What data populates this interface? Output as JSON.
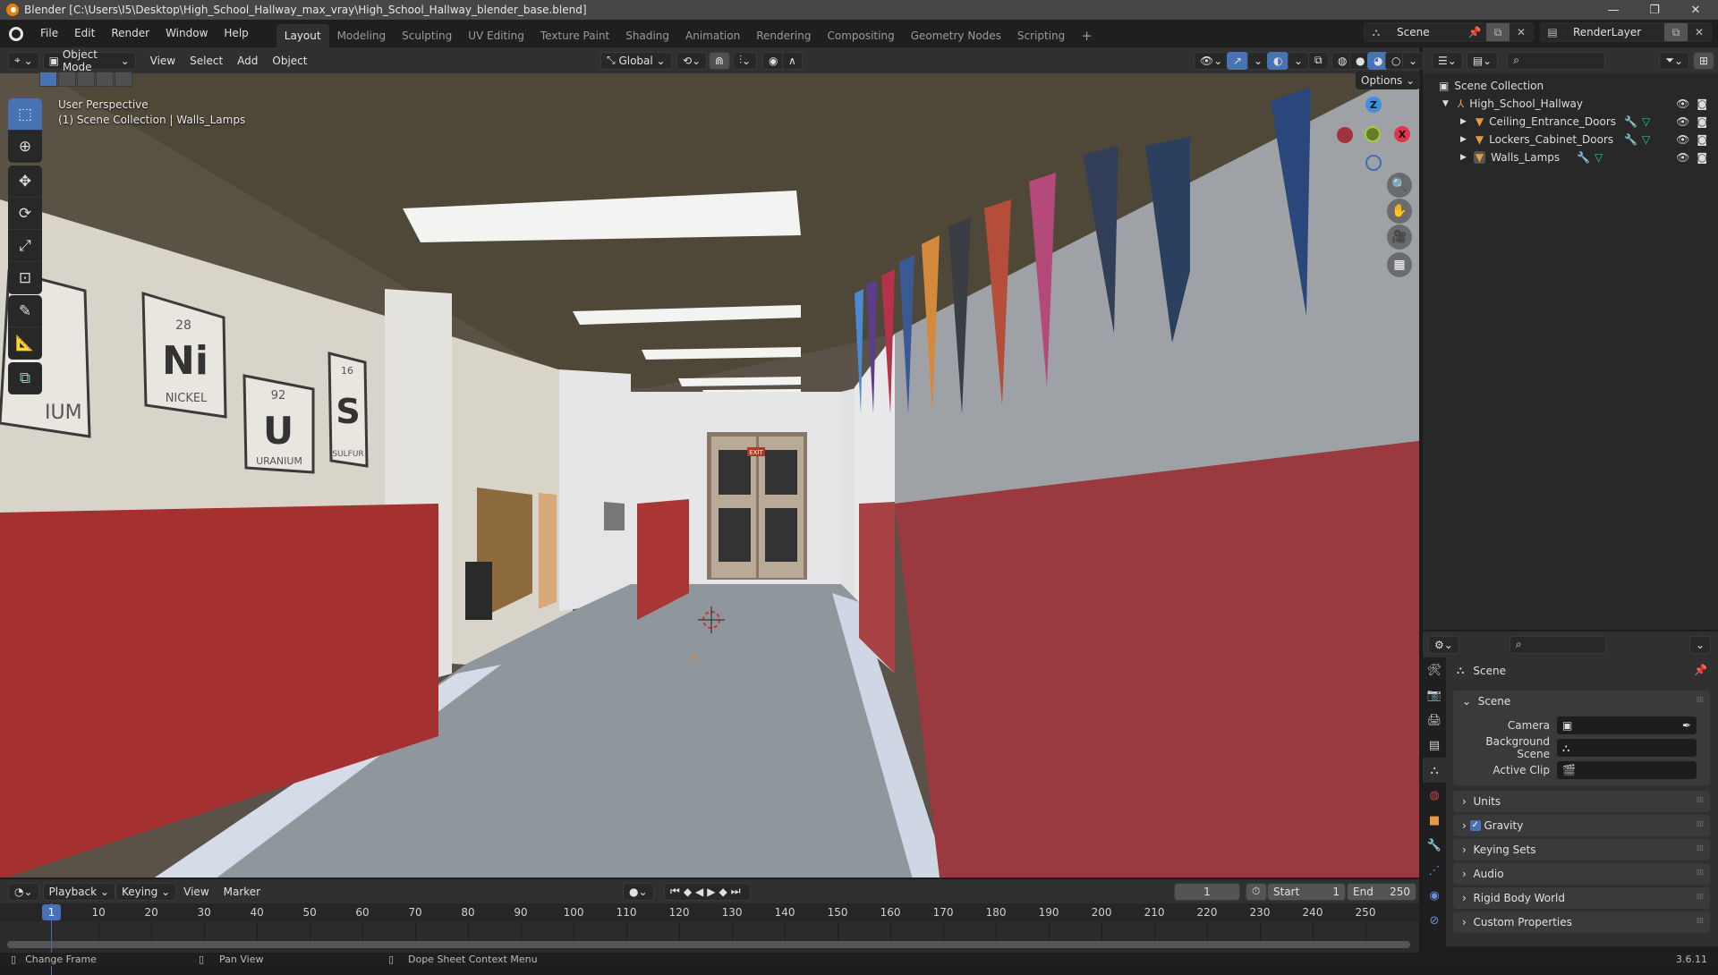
{
  "window": {
    "title": "Blender [C:\\Users\\I5\\Desktop\\High_School_Hallway_max_vray\\High_School_Hallway_blender_base.blend]",
    "controls": [
      "minimize",
      "maximize",
      "close"
    ]
  },
  "menubar": {
    "items": [
      "File",
      "Edit",
      "Render",
      "Window",
      "Help"
    ],
    "workspaces": [
      "Layout",
      "Modeling",
      "Sculpting",
      "UV Editing",
      "Texture Paint",
      "Shading",
      "Animation",
      "Rendering",
      "Compositing",
      "Geometry Nodes",
      "Scripting"
    ],
    "active_workspace": "Layout",
    "add_workspace": "+",
    "scene": "Scene",
    "view_layer": "RenderLayer"
  },
  "viewport": {
    "mode": "Object Mode",
    "menus": [
      "View",
      "Select",
      "Add",
      "Object"
    ],
    "transform_orientation": "Global",
    "options_label": "Options",
    "overlay_line1": "User Perspective",
    "overlay_line2": "(1) Scene Collection | Walls_Lamps",
    "gizmo_axes": [
      "Z",
      "X"
    ],
    "shading_mode_active": "material-preview",
    "tools": [
      "select-box",
      "cursor",
      "move",
      "rotate",
      "scale",
      "transform",
      "annotate",
      "measure",
      "add-cube"
    ],
    "scene_text": {
      "signs": [
        {
          "number": "28",
          "symbol": "Ni",
          "name": "NICKEL"
        },
        {
          "number": "92",
          "symbol": "U",
          "name": "URANIUM"
        },
        {
          "number": "16",
          "symbol": "S",
          "name": "SULFUR"
        }
      ],
      "partial_sign": "IUM",
      "exit_sign": "EXIT"
    }
  },
  "outliner": {
    "root": "Scene Collection",
    "collection": "High_School_Hallway",
    "objects": [
      {
        "name": "Ceiling_Entrance_Doors"
      },
      {
        "name": "Lockers_Cabinet_Doors"
      },
      {
        "name": "Walls_Lamps"
      }
    ]
  },
  "properties": {
    "context": "Scene",
    "panels": {
      "scene": {
        "title": "Scene",
        "fields": [
          {
            "label": "Camera",
            "value": ""
          },
          {
            "label": "Background Scene",
            "value": ""
          },
          {
            "label": "Active Clip",
            "value": ""
          }
        ]
      },
      "collapsed": [
        "Units",
        "Gravity",
        "Keying Sets",
        "Audio",
        "Rigid Body World",
        "Custom Properties"
      ],
      "gravity_checked": true
    }
  },
  "timeline": {
    "menus": [
      "Playback",
      "Keying",
      "View",
      "Marker"
    ],
    "current_frame": "1",
    "start_label": "Start",
    "start": "1",
    "end_label": "End",
    "end": "250",
    "ticks": [
      "10",
      "20",
      "30",
      "40",
      "50",
      "60",
      "70",
      "80",
      "90",
      "100",
      "110",
      "120",
      "130",
      "140",
      "150",
      "160",
      "170",
      "180",
      "190",
      "200",
      "210",
      "220",
      "230",
      "240",
      "250"
    ]
  },
  "statusbar": {
    "hints": [
      "Change Frame",
      "Pan View",
      "Dope Sheet Context Menu"
    ],
    "version": "3.6.11"
  },
  "colors": {
    "accent": "#4772b3",
    "axis_x": "#e2344b",
    "axis_y": "#8bc34a",
    "axis_z": "#3f8ee0",
    "object_orange": "#e39a4a",
    "modifier_blue": "#6d8fe0",
    "mesh_green": "#2ec2a0"
  }
}
